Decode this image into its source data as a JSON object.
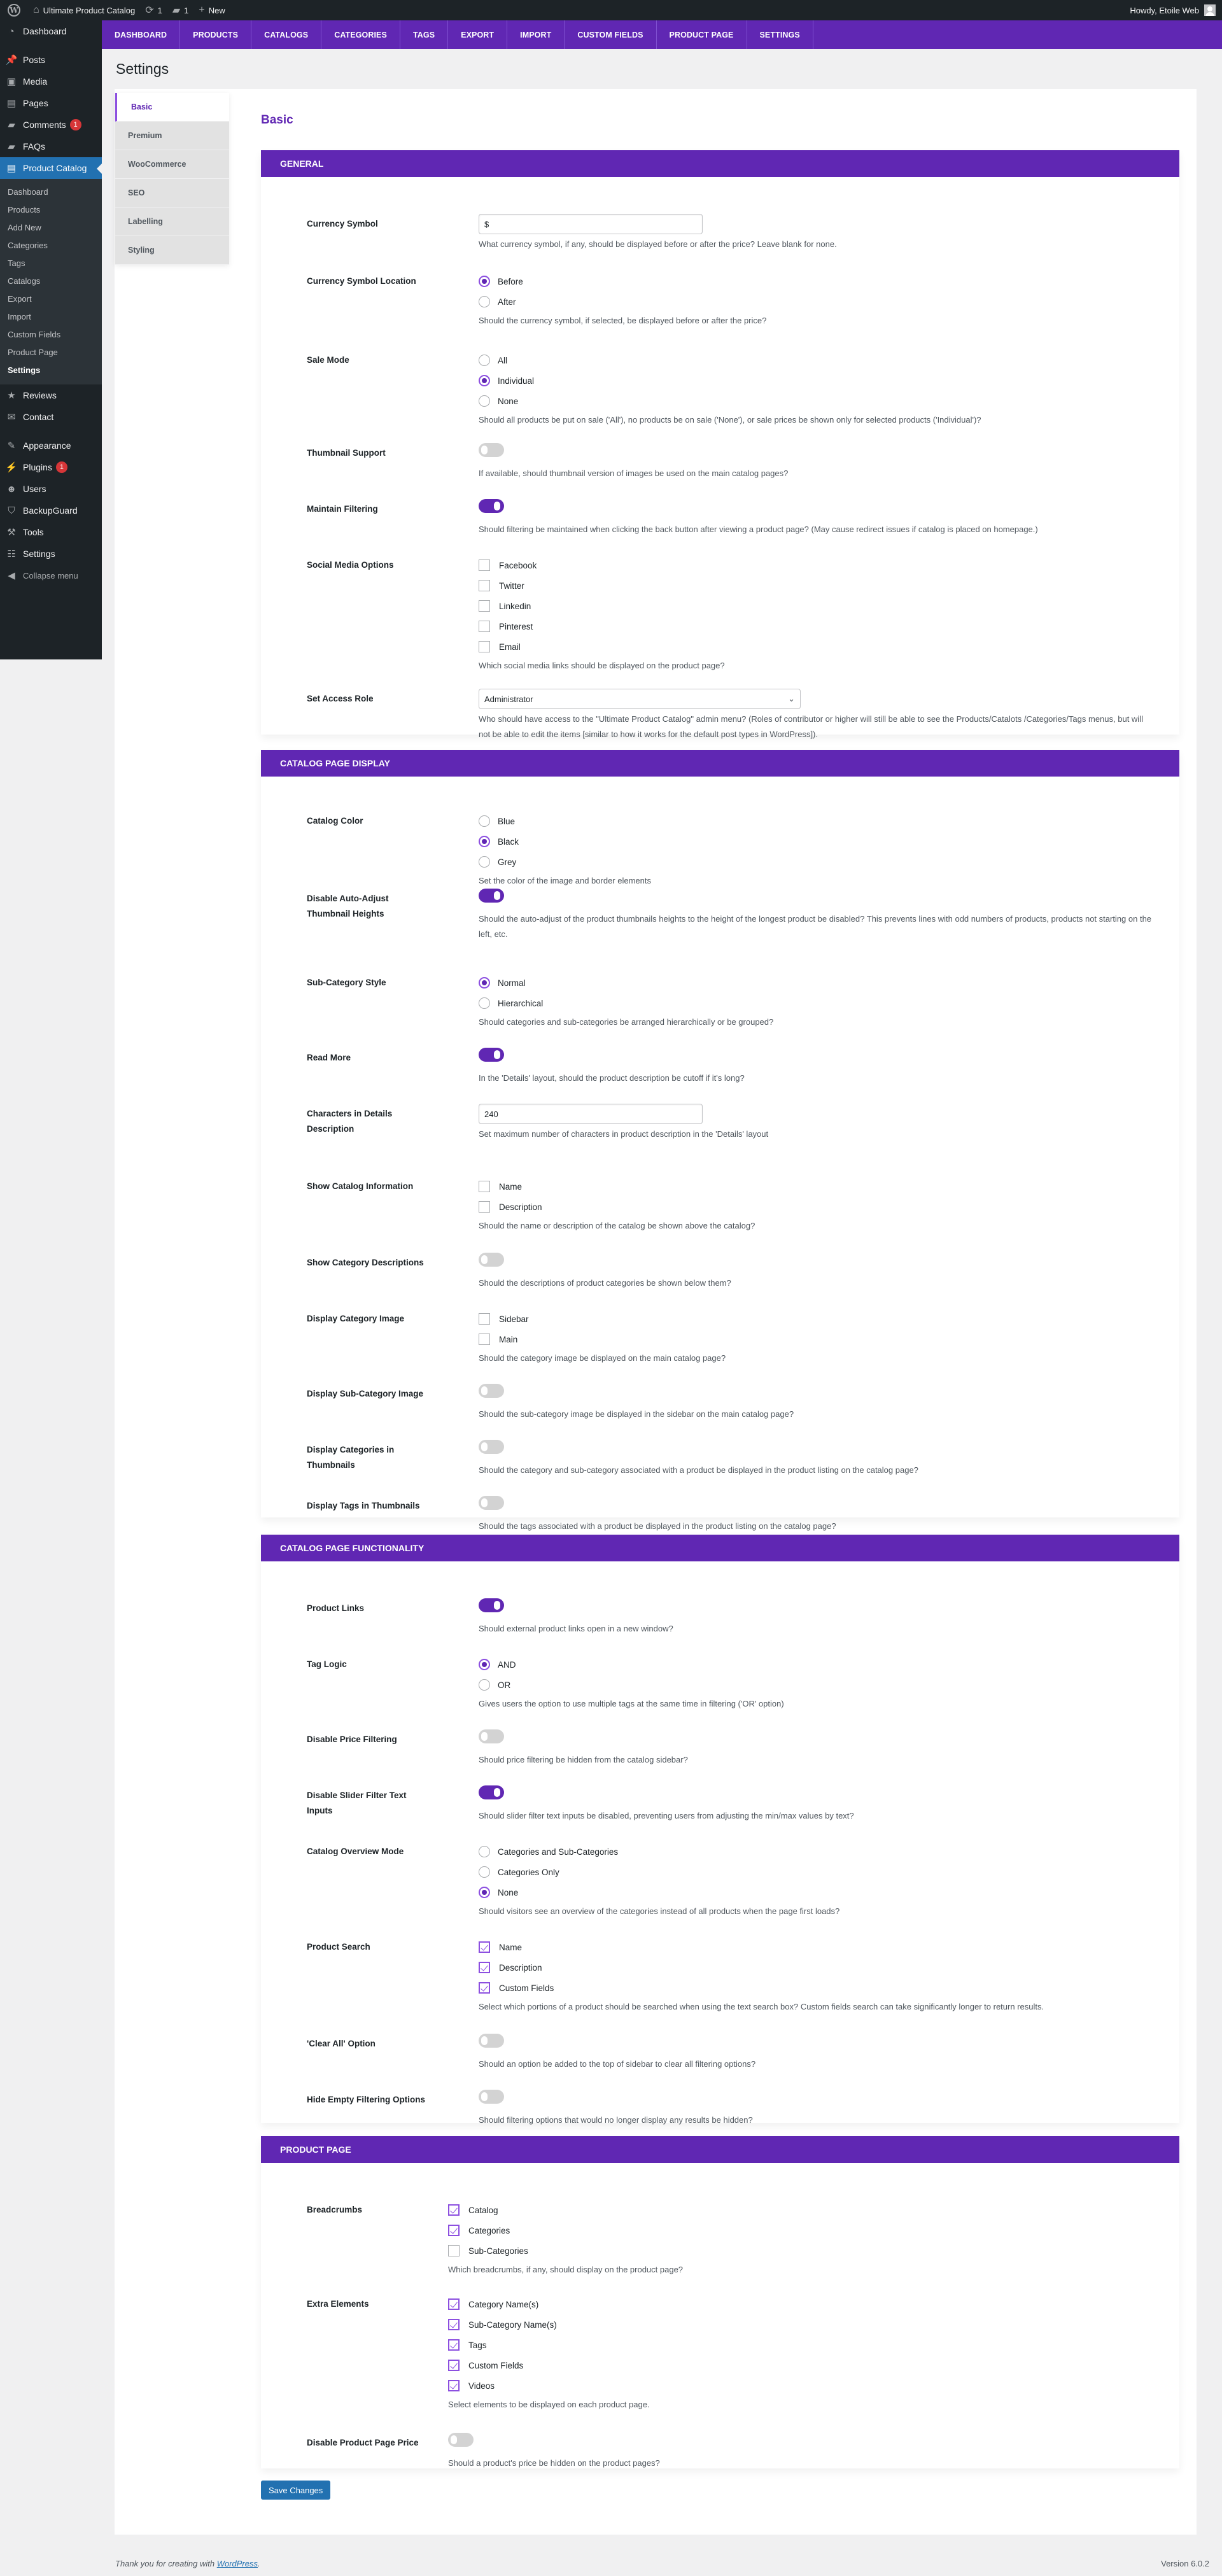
{
  "adminbar": {
    "site_name": "Ultimate Product Catalog",
    "updates_count": "1",
    "comments_count": "1",
    "new_label": "New",
    "howdy": "Howdy, Etoile Web"
  },
  "sidebar": {
    "items_top": [
      {
        "label": "Dashboard",
        "icon": "dashboard-icon",
        "glyph": "◔"
      }
    ],
    "items_content": [
      {
        "label": "Posts",
        "icon": "pin-icon",
        "glyph": "📌"
      },
      {
        "label": "Media",
        "icon": "media-icon",
        "glyph": "▣"
      },
      {
        "label": "Pages",
        "icon": "pages-icon",
        "glyph": "▤"
      },
      {
        "label": "Comments",
        "icon": "comment-icon",
        "glyph": "▰",
        "badge": "1"
      },
      {
        "label": "FAQs",
        "icon": "faq-icon",
        "glyph": "▰"
      }
    ],
    "current": {
      "label": "Product Catalog",
      "icon": "catalog-icon",
      "glyph": "▤"
    },
    "submenu": [
      {
        "label": "Dashboard",
        "current": false
      },
      {
        "label": "Products",
        "current": false
      },
      {
        "label": "Add New",
        "current": false
      },
      {
        "label": "Categories",
        "current": false
      },
      {
        "label": "Tags",
        "current": false
      },
      {
        "label": "Catalogs",
        "current": false
      },
      {
        "label": "Export",
        "current": false
      },
      {
        "label": "Import",
        "current": false
      },
      {
        "label": "Custom Fields",
        "current": false
      },
      {
        "label": "Product Page",
        "current": false
      },
      {
        "label": "Settings",
        "current": true
      }
    ],
    "items_after": [
      {
        "label": "Reviews",
        "icon": "star-icon",
        "glyph": "★"
      },
      {
        "label": "Contact",
        "icon": "envelope-icon",
        "glyph": "✉"
      }
    ],
    "items_bottom": [
      {
        "label": "Appearance",
        "icon": "paintbrush-icon",
        "glyph": "✎"
      },
      {
        "label": "Plugins",
        "icon": "plugin-icon",
        "glyph": "⚡",
        "badge": "1"
      },
      {
        "label": "Users",
        "icon": "user-icon",
        "glyph": "☻"
      },
      {
        "label": "BackupGuard",
        "icon": "shield-icon",
        "glyph": "⛉"
      },
      {
        "label": "Tools",
        "icon": "wrench-icon",
        "glyph": "⚒"
      },
      {
        "label": "Settings",
        "icon": "settings-icon",
        "glyph": "☷"
      }
    ],
    "collapse_label": "Collapse menu"
  },
  "plugin_nav": [
    "DASHBOARD",
    "PRODUCTS",
    "CATALOGS",
    "CATEGORIES",
    "TAGS",
    "EXPORT",
    "IMPORT",
    "CUSTOM FIELDS",
    "PRODUCT PAGE",
    "SETTINGS"
  ],
  "page_title": "Settings",
  "tabs": [
    {
      "label": "Basic",
      "active": true
    },
    {
      "label": "Premium",
      "active": false
    },
    {
      "label": "WooCommerce",
      "active": false
    },
    {
      "label": "SEO",
      "active": false
    },
    {
      "label": "Labelling",
      "active": false
    },
    {
      "label": "Styling",
      "active": false
    }
  ],
  "section_heading": "Basic",
  "colors": {
    "accent": "#6027b3",
    "save_button": "#2271b1"
  },
  "sections": [
    {
      "title": "GENERAL",
      "rows": [
        {
          "label": "Currency Symbol",
          "type": "text",
          "value": "$",
          "desc": "What currency symbol, if any, should be displayed before or after the price? Leave blank for none."
        },
        {
          "label": "Currency Symbol Location",
          "type": "radio",
          "options": [
            {
              "label": "Before",
              "on": true
            },
            {
              "label": "After",
              "on": false
            }
          ],
          "desc": "Should the currency symbol, if selected, be displayed before or after the price?"
        },
        {
          "label": "Sale Mode",
          "type": "radio",
          "options": [
            {
              "label": "All",
              "on": false
            },
            {
              "label": "Individual",
              "on": true
            },
            {
              "label": "None",
              "on": false
            }
          ],
          "desc": "Should all products be put on sale ('All'), no products be on sale ('None'), or sale prices be shown only for selected products ('Individual')?"
        },
        {
          "label": "Thumbnail Support",
          "type": "toggle",
          "on": false,
          "desc": "If available, should thumbnail version of images be used on the main catalog pages?"
        },
        {
          "label": "Maintain Filtering",
          "type": "toggle",
          "on": true,
          "desc": "Should filtering be maintained when clicking the back button after viewing a product page? (May cause redirect issues if catalog is placed on homepage.)"
        },
        {
          "label": "Social Media Options",
          "type": "check",
          "options": [
            {
              "label": "Facebook",
              "on": false
            },
            {
              "label": "Twitter",
              "on": false
            },
            {
              "label": "Linkedin",
              "on": false
            },
            {
              "label": "Pinterest",
              "on": false
            },
            {
              "label": "Email",
              "on": false
            }
          ],
          "desc": "Which social media links should be displayed on the product page?"
        },
        {
          "label": "Set Access Role",
          "type": "select",
          "value": "Administrator",
          "desc": "Who should have access to the \"Ultimate Product Catalog\" admin menu? (Roles of contributor or higher will still be able to see the Products/Catalots /Categories/Tags menus, but will not be able to edit the items [similar to how it works for the default post types in WordPress])."
        }
      ]
    },
    {
      "title": "CATALOG PAGE DISPLAY",
      "rows": [
        {
          "label": "Catalog Color",
          "type": "radio",
          "options": [
            {
              "label": "Blue",
              "on": false
            },
            {
              "label": "Black",
              "on": true
            },
            {
              "label": "Grey",
              "on": false
            }
          ],
          "desc": "Set the color of the image and border elements"
        },
        {
          "label": "Disable Auto-Adjust Thumbnail Heights",
          "type": "toggle",
          "on": true,
          "desc": "Should the auto-adjust of the product thumbnails heights to the height of the longest product be disabled? This prevents lines with odd numbers of products, products not starting on the left, etc."
        },
        {
          "label": "Sub-Category Style",
          "type": "radio",
          "options": [
            {
              "label": "Normal",
              "on": true
            },
            {
              "label": "Hierarchical",
              "on": false
            }
          ],
          "desc": "Should categories and sub-categories be arranged hierarchically or be grouped?"
        },
        {
          "label": "Read More",
          "type": "toggle",
          "on": true,
          "desc": "In the 'Details' layout, should the product description be cutoff if it's long?"
        },
        {
          "label": "Characters in Details Description",
          "type": "text",
          "value": "240",
          "desc": "Set maximum number of characters in product description in the 'Details' layout"
        },
        {
          "label": "Show Catalog Information",
          "type": "check",
          "options": [
            {
              "label": "Name",
              "on": false
            },
            {
              "label": "Description",
              "on": false
            }
          ],
          "desc": "Should the name or description of the catalog be shown above the catalog?"
        },
        {
          "label": "Show Category Descriptions",
          "type": "toggle",
          "on": false,
          "desc": "Should the descriptions of product categories be shown below them?"
        },
        {
          "label": "Display Category Image",
          "type": "check",
          "options": [
            {
              "label": "Sidebar",
              "on": false
            },
            {
              "label": "Main",
              "on": false
            }
          ],
          "desc": "Should the category image be displayed on the main catalog page?"
        },
        {
          "label": "Display Sub-Category Image",
          "type": "toggle",
          "on": false,
          "desc": "Should the sub-category image be displayed in the sidebar on the main catalog page?"
        },
        {
          "label": "Display Categories in Thumbnails",
          "type": "toggle",
          "on": false,
          "desc": "Should the category and sub-category associated with a product be displayed in the product listing on the catalog page?"
        },
        {
          "label": "Display Tags in Thumbnails",
          "type": "toggle",
          "on": false,
          "desc": "Should the tags associated with a product be displayed in the product listing on the catalog page?"
        }
      ]
    },
    {
      "title": "CATALOG PAGE FUNCTIONALITY",
      "rows": [
        {
          "label": "Product Links",
          "type": "toggle",
          "on": true,
          "desc": "Should external product links open in a new window?"
        },
        {
          "label": "Tag Logic",
          "type": "radio",
          "options": [
            {
              "label": "AND",
              "on": true
            },
            {
              "label": "OR",
              "on": false
            }
          ],
          "desc": "Gives users the option to use multiple tags at the same time in filtering ('OR' option)"
        },
        {
          "label": "Disable Price Filtering",
          "type": "toggle",
          "on": false,
          "desc": "Should price filtering be hidden from the catalog sidebar?"
        },
        {
          "label": "Disable Slider Filter Text Inputs",
          "type": "toggle",
          "on": true,
          "desc": "Should slider filter text inputs be disabled, preventing users from adjusting the min/max values by text?"
        },
        {
          "label": "Catalog Overview Mode",
          "type": "radio",
          "options": [
            {
              "label": "Categories and Sub-Categories",
              "on": false
            },
            {
              "label": "Categories Only",
              "on": false
            },
            {
              "label": "None",
              "on": true
            }
          ],
          "desc": "Should visitors see an overview of the categories instead of all products when the page first loads?"
        },
        {
          "label": "Product Search",
          "type": "check",
          "options": [
            {
              "label": "Name",
              "on": true
            },
            {
              "label": "Description",
              "on": true
            },
            {
              "label": "Custom Fields",
              "on": true
            }
          ],
          "desc": "Select which portions of a product should be searched when using the text search box? Custom fields search can take significantly longer to return results."
        },
        {
          "label": "'Clear All' Option",
          "type": "toggle",
          "on": false,
          "desc": "Should an option be added to the top of sidebar to clear all filtering options?"
        },
        {
          "label": "Hide Empty Filtering Options",
          "type": "toggle",
          "on": false,
          "desc": "Should filtering options that would no longer display any results be hidden?"
        }
      ]
    },
    {
      "title": "PRODUCT PAGE",
      "rows": [
        {
          "label": "Breadcrumbs",
          "type": "check",
          "options": [
            {
              "label": "Catalog",
              "on": true
            },
            {
              "label": "Categories",
              "on": true
            },
            {
              "label": "Sub-Categories",
              "on": false
            }
          ],
          "desc": "Which breadcrumbs, if any, should display on the product page?"
        },
        {
          "label": "Extra Elements",
          "type": "check",
          "options": [
            {
              "label": "Category Name(s)",
              "on": true
            },
            {
              "label": "Sub-Category Name(s)",
              "on": true
            },
            {
              "label": "Tags",
              "on": true
            },
            {
              "label": "Custom Fields",
              "on": true
            },
            {
              "label": "Videos",
              "on": true
            }
          ],
          "desc": "Select elements to be displayed on each product page."
        },
        {
          "label": "Disable Product Page Price",
          "type": "toggle",
          "on": false,
          "desc": "Should a product's price be hidden on the product pages?"
        }
      ]
    }
  ],
  "save_label": "Save Changes",
  "footer": {
    "thanks_prefix": "Thank you for creating with ",
    "wp_link": "WordPress",
    "thanks_suffix": ".",
    "version": "Version 6.0.2"
  }
}
